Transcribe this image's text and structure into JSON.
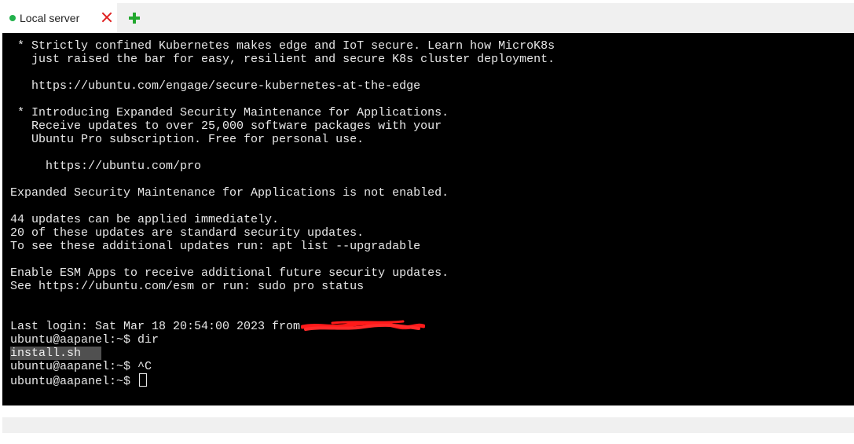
{
  "tab": {
    "label": "Local server",
    "status_color": "#22b14c"
  },
  "terminal": {
    "lines": [
      " * Strictly confined Kubernetes makes edge and IoT secure. Learn how MicroK8s",
      "   just raised the bar for easy, resilient and secure K8s cluster deployment.",
      "",
      "   https://ubuntu.com/engage/secure-kubernetes-at-the-edge",
      "",
      " * Introducing Expanded Security Maintenance for Applications.",
      "   Receive updates to over 25,000 software packages with your",
      "   Ubuntu Pro subscription. Free for personal use.",
      "",
      "     https://ubuntu.com/pro",
      "",
      "Expanded Security Maintenance for Applications is not enabled.",
      "",
      "44 updates can be applied immediately.",
      "20 of these updates are standard security updates.",
      "To see these additional updates run: apt list --upgradable",
      "",
      "Enable ESM Apps to receive additional future security updates.",
      "See https://ubuntu.com/esm or run: sudo pro status",
      "",
      "",
      "Last login: Sat Mar 18 20:54:00 2023 from ",
      "ubuntu@aapanel:~$ dir"
    ],
    "selected_line": "install.sh",
    "after_lines": [
      "ubuntu@aapanel:~$ ^C"
    ],
    "prompt": "ubuntu@aapanel:~$ "
  }
}
